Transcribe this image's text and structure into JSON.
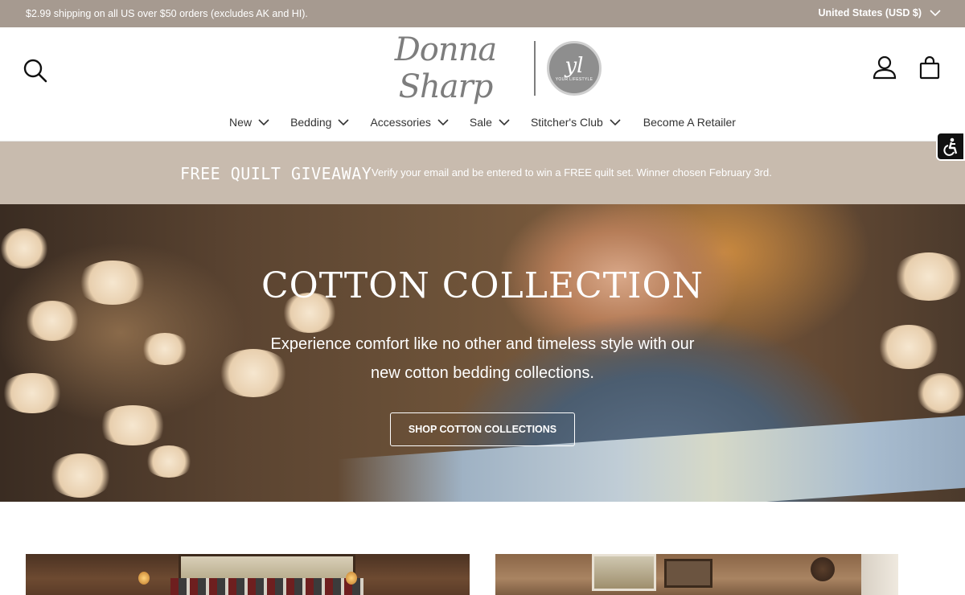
{
  "announcement": {
    "message": "$2.99 shipping on all US over $50 orders (excludes AK and HI).",
    "country": "United States (USD $)"
  },
  "header": {
    "logo_text": "Donna Sharp",
    "logo_badge": "yl",
    "logo_badge_small": "YOUR LIFESTYLE",
    "icons": [
      "search-icon",
      "account-icon",
      "cart-icon",
      "accessibility-icon"
    ]
  },
  "nav": {
    "items": [
      {
        "label": "New"
      },
      {
        "label": "Bedding"
      },
      {
        "label": "Accessories"
      },
      {
        "label": "Sale"
      },
      {
        "label": "Stitcher's Club"
      },
      {
        "label": "Become A Retailer"
      }
    ]
  },
  "giveaway": {
    "title": "FREE QUILT GIVEAWAY",
    "text": "Verify your email and be entered to win a FREE quilt set. Winner chosen February 3rd."
  },
  "hero": {
    "headline": "COTTON COLLECTION",
    "subtext": "Experience comfort like no other and timeless style with our new cotton bedding collections.",
    "cta": "SHOP COTTON COLLECTIONS"
  },
  "colors": {
    "announcement_bg": "#a69a90",
    "giveaway_bg": "#c8bbae",
    "accent": "#7d7d7d"
  }
}
